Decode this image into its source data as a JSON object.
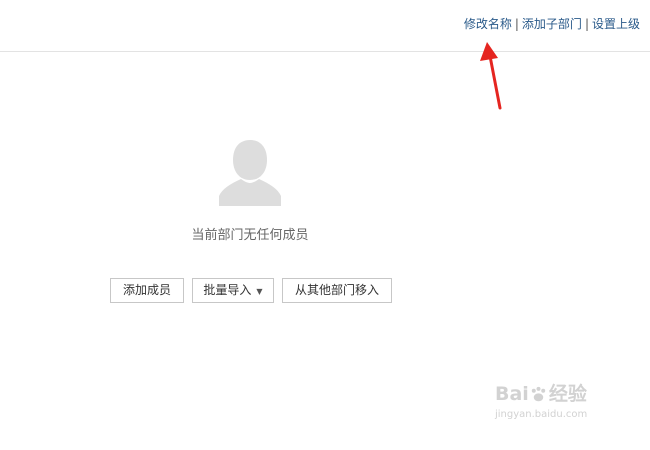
{
  "header": {
    "actions": [
      {
        "label": "修改名称"
      },
      {
        "label": "添加子部门"
      },
      {
        "label": "设置上级"
      }
    ],
    "separator": "|",
    "link_color": "#2a5a8a"
  },
  "empty_state": {
    "icon": "user-silhouette-icon",
    "message": "当前部门无任何成员"
  },
  "buttons": {
    "add_member": "添加成员",
    "batch_import": "批量导入",
    "batch_import_caret": "▼",
    "move_from_other": "从其他部门移入"
  },
  "annotation": {
    "arrow_color": "#e52520"
  },
  "watermark": {
    "brand_left": "Bai",
    "brand_right": "经验",
    "site": "jingyan.baidu.com",
    "icon": "paw-icon"
  },
  "colors": {
    "border": "#c7c7c7",
    "header_divider": "#e3e3e3",
    "avatar": "#dddddd"
  }
}
